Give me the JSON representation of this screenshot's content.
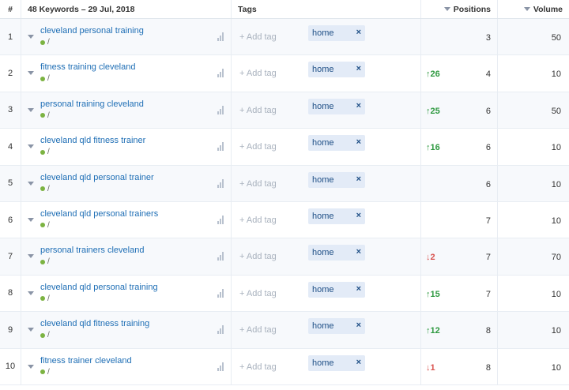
{
  "header": {
    "num": "#",
    "keywords": "48 Keywords – 29 Jul, 2018",
    "tags": "Tags",
    "positions": "Positions",
    "volume": "Volume"
  },
  "add_tag_label": "+ Add tag",
  "rows": [
    {
      "num": "1",
      "keyword": "cleveland personal training",
      "sub": "/",
      "tag": "home",
      "tag_x": "×",
      "change": "",
      "change_dir": "",
      "position": "3",
      "volume": "50"
    },
    {
      "num": "2",
      "keyword": "fitness training cleveland",
      "sub": "/",
      "tag": "home",
      "tag_x": "×",
      "change": "↑26",
      "change_dir": "up",
      "position": "4",
      "volume": "10"
    },
    {
      "num": "3",
      "keyword": "personal training cleveland",
      "sub": "/",
      "tag": "home",
      "tag_x": "×",
      "change": "↑25",
      "change_dir": "up",
      "position": "6",
      "volume": "50"
    },
    {
      "num": "4",
      "keyword": "cleveland qld fitness trainer",
      "sub": "/",
      "tag": "home",
      "tag_x": "×",
      "change": "↑16",
      "change_dir": "up",
      "position": "6",
      "volume": "10"
    },
    {
      "num": "5",
      "keyword": "cleveland qld personal trainer",
      "sub": "/",
      "tag": "home",
      "tag_x": "×",
      "change": "",
      "change_dir": "",
      "position": "6",
      "volume": "10"
    },
    {
      "num": "6",
      "keyword": "cleveland qld personal trainers",
      "sub": "/",
      "tag": "home",
      "tag_x": "×",
      "change": "",
      "change_dir": "",
      "position": "7",
      "volume": "10"
    },
    {
      "num": "7",
      "keyword": "personal trainers cleveland",
      "sub": "/",
      "tag": "home",
      "tag_x": "×",
      "change": "↓2",
      "change_dir": "down",
      "position": "7",
      "volume": "70"
    },
    {
      "num": "8",
      "keyword": "cleveland qld personal training",
      "sub": "/",
      "tag": "home",
      "tag_x": "×",
      "change": "↑15",
      "change_dir": "up",
      "position": "7",
      "volume": "10"
    },
    {
      "num": "9",
      "keyword": "cleveland qld fitness training",
      "sub": "/",
      "tag": "home",
      "tag_x": "×",
      "change": "↑12",
      "change_dir": "up",
      "position": "8",
      "volume": "10"
    },
    {
      "num": "10",
      "keyword": "fitness trainer cleveland",
      "sub": "/",
      "tag": "home",
      "tag_x": "×",
      "change": "↓1",
      "change_dir": "down",
      "position": "8",
      "volume": "10"
    }
  ],
  "colors": {
    "keyword_link": "#1e6eb5",
    "status_dot": "#7cb342",
    "change_up": "#2e9940",
    "change_down": "#d9534f",
    "tag_bg": "#e3ebf7"
  }
}
